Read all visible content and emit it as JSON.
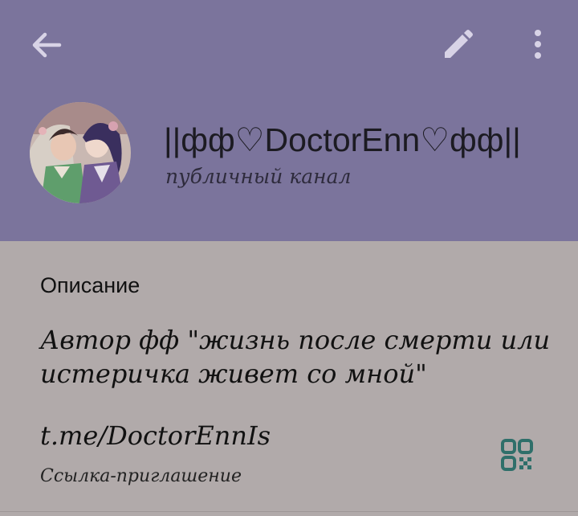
{
  "colors": {
    "header_bg": "#7b749c",
    "content_bg": "#b1aaaa",
    "icon_light": "#d8d3e6",
    "qr_accent": "#2f6f6a"
  },
  "toolbar": {
    "back_icon": "arrow-left-icon",
    "edit_icon": "pencil-icon",
    "more_icon": "more-vertical-icon"
  },
  "channel": {
    "name": "||фф♡DoctorEnn♡фф||",
    "type": "публичный канал",
    "avatar": "channel-avatar"
  },
  "info": {
    "description_title": "Описание",
    "description_lines": [
      "Автор фф \"жизнь после смерти или",
      "истеричка живет со мной\""
    ],
    "link": "t.me/DoctorEnnIs",
    "link_caption": "Ссылка-приглашение",
    "qr_icon": "qr-code-icon"
  }
}
